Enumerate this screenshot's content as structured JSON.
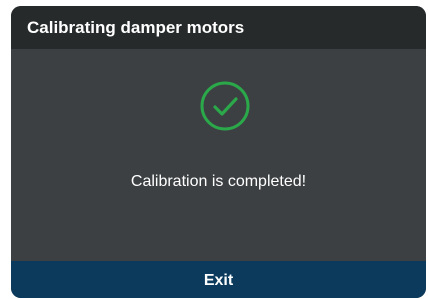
{
  "dialog": {
    "title": "Calibrating damper motors",
    "status_icon": "check-circle-icon",
    "message": "Calibration is completed!",
    "exit_label": "Exit"
  },
  "colors": {
    "header_bg": "#262a2b",
    "body_bg": "#3c4042",
    "footer_bg": "#0b3a5c",
    "success_green": "#2aa84a",
    "text": "#ffffff"
  }
}
